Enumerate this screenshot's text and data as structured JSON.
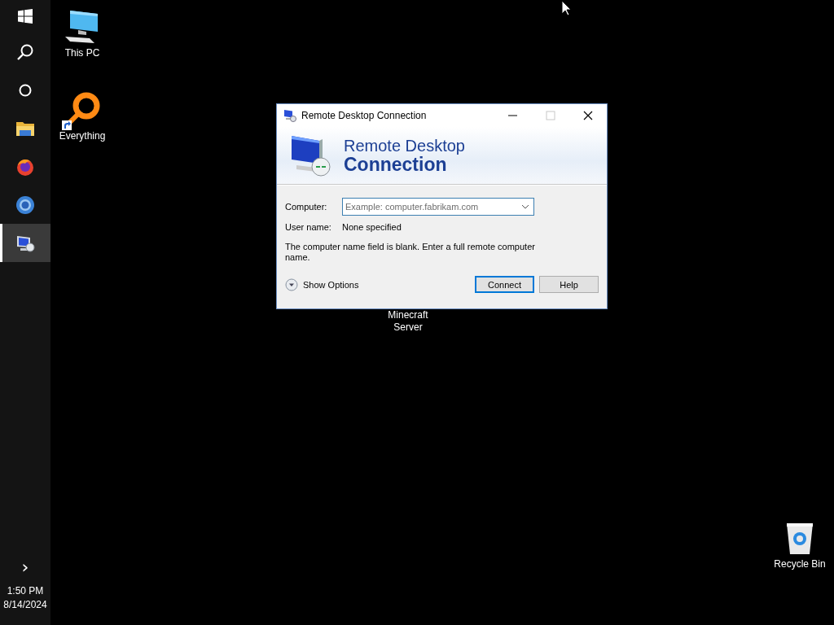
{
  "taskbar": {
    "items": [
      {
        "kind": "start",
        "selected": false
      },
      {
        "kind": "search",
        "selected": false
      },
      {
        "kind": "cortana",
        "selected": false
      },
      {
        "kind": "folder",
        "selected": false
      },
      {
        "kind": "firefox",
        "selected": false
      },
      {
        "kind": "chrome",
        "selected": false
      },
      {
        "kind": "rdp",
        "selected": true
      }
    ],
    "expand": "›",
    "clock": {
      "time": "1:50 PM",
      "date": "8/14/2024"
    }
  },
  "desktop": {
    "icons": [
      {
        "kind": "computer",
        "label": "This PC",
        "shortcut": false
      },
      {
        "kind": "everything",
        "label": "Everything",
        "shortcut": true
      },
      {
        "kind": "covered",
        "label": "Minecraft Server",
        "shortcut": false
      },
      {
        "kind": "recycle",
        "label": "Recycle Bin",
        "shortcut": false
      }
    ]
  },
  "window": {
    "title": "Remote Desktop Connection",
    "controls": [
      {
        "kind": "minimize",
        "disabled": false
      },
      {
        "kind": "maximize",
        "disabled": true
      },
      {
        "kind": "close",
        "disabled": false
      }
    ],
    "banner": {
      "line1": "Remote Desktop",
      "line2": "Connection"
    },
    "computer": {
      "label": "Computer:",
      "placeholder": "Example: computer.fabrikam.com"
    },
    "username": {
      "label": "User name:",
      "value": "None specified"
    },
    "message": "The computer name field is blank. Enter a full remote computer name.",
    "show_options": "Show Options",
    "buttons": [
      {
        "label": "Connect",
        "default": true
      },
      {
        "label": "Help",
        "default": false
      }
    ]
  }
}
